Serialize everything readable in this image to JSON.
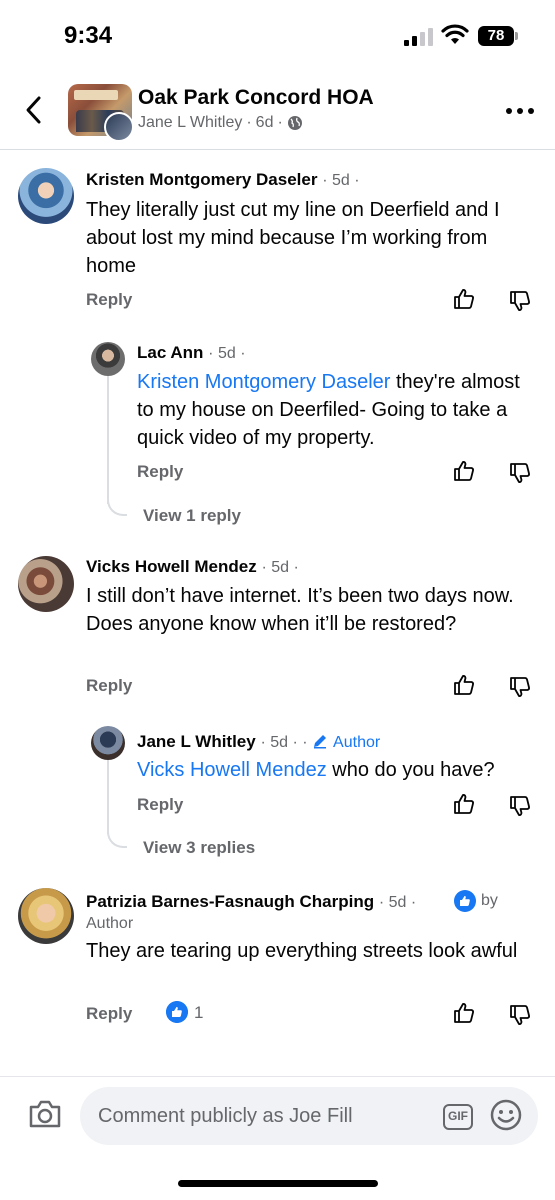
{
  "status_bar": {
    "time": "9:34",
    "battery": "78"
  },
  "header": {
    "title": "Oak Park Concord HOA",
    "author": "Jane L Whitley",
    "age": "6d",
    "separator": "·"
  },
  "comments": [
    {
      "name": "Kristen Montgomery Daseler",
      "time": "· 5d ·",
      "body": "They literally just cut my line on Deerfield and I about lost my mind because I’m working from home",
      "reply_label": "Reply"
    },
    {
      "name": "Lac Ann",
      "time": "· 5d ·",
      "mention": "Kristen Montgomery Daseler",
      "body": " they're almost to my house on Deerfiled- Going to take a quick video of my property.",
      "reply_label": "Reply",
      "view_replies": "View 1 reply"
    },
    {
      "name": "Vicks Howell Mendez",
      "time": "· 5d ·",
      "body": "I still don’t have internet. It’s been two days now. Does anyone know when it’ll be restored?",
      "reply_label": "Reply"
    },
    {
      "name": "Jane L Whitley",
      "time": "· 5d ·  ·",
      "author_tag": "Author",
      "mention": "Vicks Howell Mendez",
      "body": " who do you have?",
      "reply_label": "Reply",
      "view_replies": "View 3 replies"
    },
    {
      "name": "Patrizia Barnes-Fasnaugh Charping",
      "time": "· 5d ·",
      "liked_by": "by",
      "liked_by_line2": "Author",
      "body": "They are tearing up everything streets look awful",
      "reply_label": "Reply",
      "like_count": "1"
    }
  ],
  "composer": {
    "placeholder": "Comment publicly as Joe Fill",
    "gif_label": "GIF"
  },
  "colors": {
    "link": "#1877f2",
    "muted": "#65676b",
    "text": "#050505"
  }
}
